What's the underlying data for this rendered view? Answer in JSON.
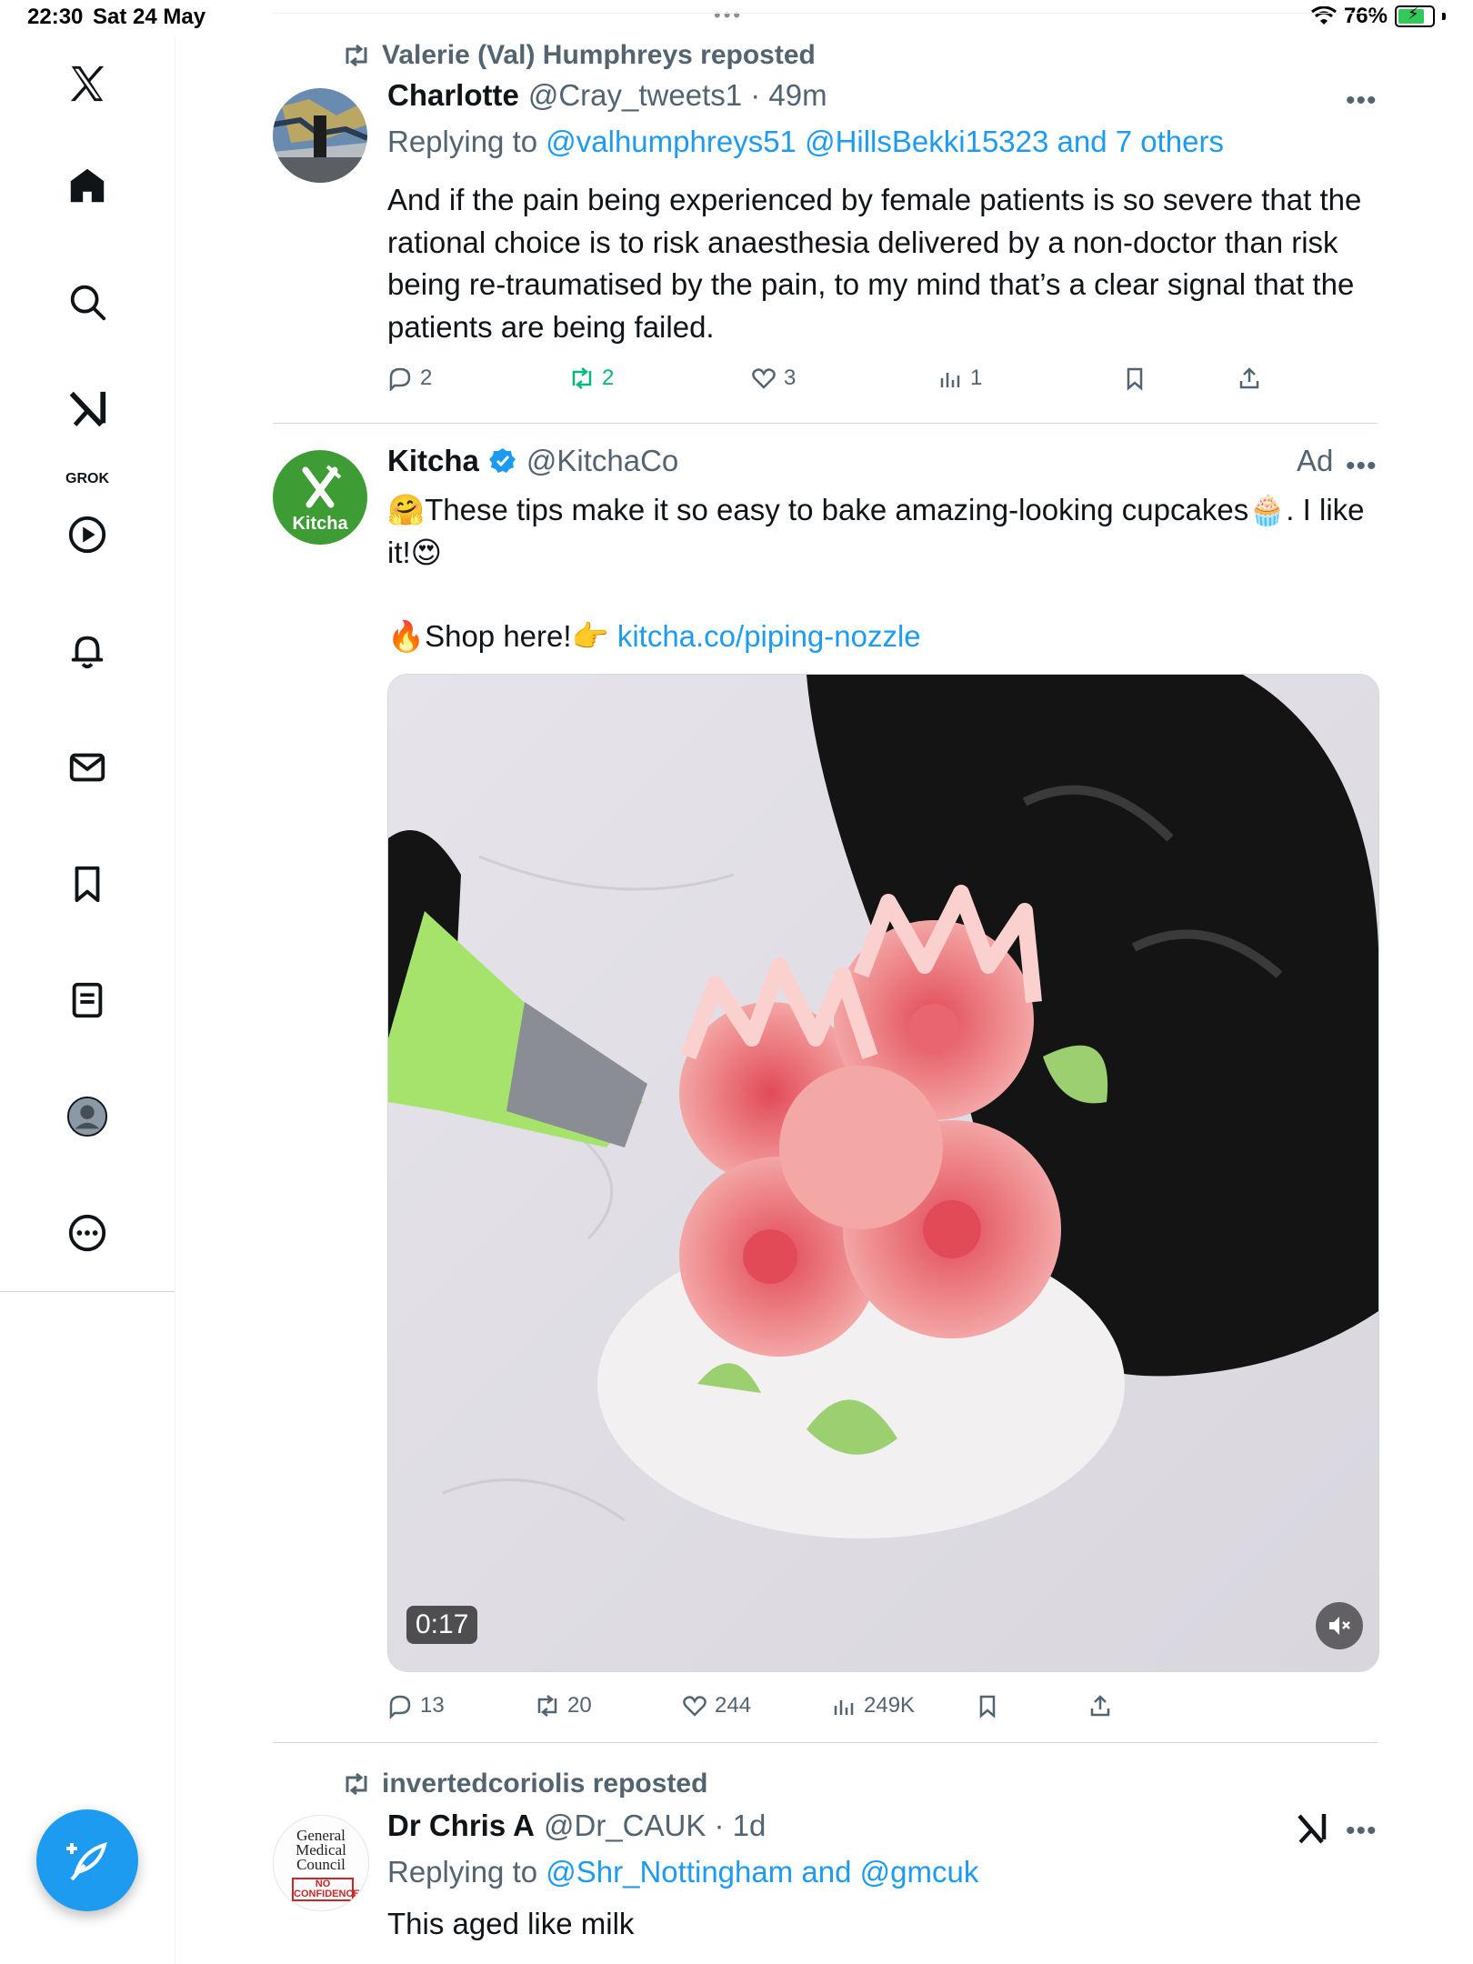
{
  "status_bar": {
    "time": "22:30",
    "date": "Sat 24 May",
    "battery": "76%",
    "battery_level": 0.76
  },
  "sidebar": {
    "items": [
      {
        "name": "x-logo-icon"
      },
      {
        "name": "home-icon"
      },
      {
        "name": "search-icon"
      },
      {
        "name": "grok-icon",
        "label": "GROK"
      },
      {
        "name": "video-icon"
      },
      {
        "name": "notifications-icon"
      },
      {
        "name": "messages-icon"
      },
      {
        "name": "bookmarks-icon"
      },
      {
        "name": "lists-icon"
      },
      {
        "name": "profile-icon"
      },
      {
        "name": "more-icon"
      }
    ]
  },
  "feed": {
    "tweet1": {
      "repost_by": "Valerie (Val) Humphreys reposted",
      "name": "Charlotte",
      "handle_time": "@Cray_tweets1 · 49m",
      "replying_prefix": "Replying to ",
      "replying_links": "@valhumphreys51 @HillsBekki15323 and 7 others",
      "text": "And if the pain being experienced by female patients is so severe that the rational choice is to risk anaesthesia delivered by a non-doctor than risk being re-traumatised by the pain, to my mind that’s a clear signal that the patients are being failed.",
      "replies": "2",
      "reposts": "2",
      "likes": "3",
      "views": "1"
    },
    "tweet2": {
      "name": "Kitcha",
      "handle": "@KitchaCo",
      "ad_label": "Ad",
      "avatar_text": "Kitcha",
      "text_line1": "🤗These tips make it so easy to bake amazing-looking cupcakes🧁. I like it!😍",
      "shop_prefix": "🔥Shop here!👉 ",
      "shop_link": "kitcha.co/piping-nozzle",
      "video_duration": "0:17",
      "replies": "13",
      "reposts": "20",
      "likes": "244",
      "views": "249K"
    },
    "tweet3": {
      "repost_by": "invertedcoriolis reposted",
      "name": "Dr Chris A",
      "handle_time": "@Dr_CAUK · 1d",
      "replying_prefix": "Replying to ",
      "replying_links": "@Shr_Nottingham and @gmcuk",
      "text": "This aged like milk",
      "avatar_line1": "General",
      "avatar_line2": "Medical",
      "avatar_line3": "Council",
      "avatar_stamp": "NO CONFIDENCE"
    }
  },
  "colors": {
    "accent": "#1d9bf0",
    "repost_green": "#00ba7c",
    "muted": "#536471",
    "kitcha_green": "#3e9c35"
  }
}
